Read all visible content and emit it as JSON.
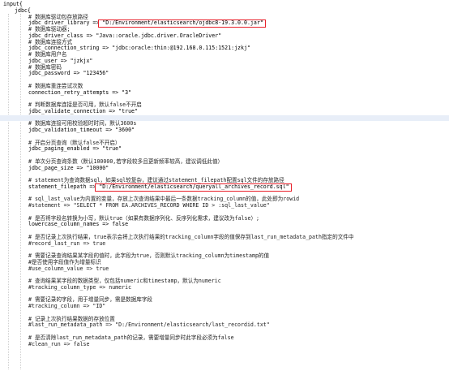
{
  "editor": {
    "colors": {
      "background": "#ffffff",
      "text": "#000000",
      "current_line": "#e8eef8",
      "highlight_box": "#e8202a"
    },
    "lines": [
      {
        "text": "input{",
        "indent": 0
      },
      {
        "text": "jdbc{",
        "indent": 1
      },
      {
        "text": "# 数据库驱动包存放路径",
        "indent": 2
      },
      {
        "text": "jdbc_driver_library => \"D:/Environment/elasticsearch/ojdbc8-19.3.0.0.jar\"",
        "indent": 2,
        "boxed": true
      },
      {
        "text": "# 数据库驱动器;",
        "indent": 2
      },
      {
        "text": "jdbc_driver_class => \"Java::oracle.jdbc.driver.OracleDriver\"",
        "indent": 2
      },
      {
        "text": "# 数据库连接方式",
        "indent": 2
      },
      {
        "text": "jdbc_connection_string => \"jdbc:oracle:thin:@192.168.0.115:1521:jzkj\"",
        "indent": 2
      },
      {
        "text": "# 数据库用户名",
        "indent": 2
      },
      {
        "text": "jdbc_user => \"jzkjx\"",
        "indent": 2
      },
      {
        "text": "# 数据库密码",
        "indent": 2
      },
      {
        "text": "jdbc_password => \"123456\"",
        "indent": 2
      },
      {
        "text": "",
        "indent": 2
      },
      {
        "text": "# 数据库重连尝试次数",
        "indent": 2
      },
      {
        "text": "connection_retry_attempts => \"3\"",
        "indent": 2
      },
      {
        "text": "",
        "indent": 2
      },
      {
        "text": "# 判断数据库连接是否可用，默认false不开启",
        "indent": 2
      },
      {
        "text": "jdbc_validate_connection => \"true\"",
        "indent": 2
      },
      {
        "text": "",
        "indent": 2,
        "current": true
      },
      {
        "text": "# 数据库连接可用校验超时时间，默认3600s",
        "indent": 2
      },
      {
        "text": "jdbc_validation_timeout => \"3600\"",
        "indent": 2
      },
      {
        "text": "",
        "indent": 2
      },
      {
        "text": "# 开启分页查询（默认false不开启）",
        "indent": 2
      },
      {
        "text": "jdbc_paging_enabled => \"true\"",
        "indent": 2
      },
      {
        "text": "",
        "indent": 2
      },
      {
        "text": "# 单次分页查询条数（默认100000,若字段较多且更新频率较高，建议调低此值）",
        "indent": 2
      },
      {
        "text": "jdbc_page_size => \"10000\"",
        "indent": 2
      },
      {
        "text": "",
        "indent": 2
      },
      {
        "text": "# statement为查询数据sql，如果sql较复杂，建议通过statement_filepath配置sql文件的存放路径",
        "indent": 2
      },
      {
        "text": "statement_filepath => \"D:/Environment/elasticsearch/queryall_archives_record.sql\"",
        "indent": 2,
        "boxed": true
      },
      {
        "text": "",
        "indent": 2
      },
      {
        "text": "# sql_last_value为内置的变量，存放上次查询结果中最后一条数据tracking_column的值，此处即为rowid",
        "indent": 2
      },
      {
        "text": "#statement => \"SELECT * FROM EA.ARCHIVES_RECORD WHERE ID > :sql_last_value\"",
        "indent": 2
      },
      {
        "text": "",
        "indent": 2
      },
      {
        "text": "# 是否将字段名转换为小写，默认true（如果有数据序列化、反序列化需求，建议改为false）;",
        "indent": 2
      },
      {
        "text": "lowercase_column_names => false",
        "indent": 2
      },
      {
        "text": "",
        "indent": 2
      },
      {
        "text": "# 是否记录上次执行结果，true表示会将上次执行结果的tracking_column字段的值保存到last_run_metadata_path指定的文件中",
        "indent": 2
      },
      {
        "text": "#record_last_run => true",
        "indent": 2
      },
      {
        "text": "",
        "indent": 2
      },
      {
        "text": "# 需要记录查询结果某字段的值时，此字段为true，否则默认tracking_column为timestamp的值",
        "indent": 2
      },
      {
        "text": "#是否使用字段值作为增量标识",
        "indent": 2
      },
      {
        "text": "#use_column_value => true",
        "indent": 2
      },
      {
        "text": "",
        "indent": 2
      },
      {
        "text": "# 查询结果某字段的数据类型，仅包括numeric和timestamp，默认为numeric",
        "indent": 2
      },
      {
        "text": "#tracking_column_type => numeric",
        "indent": 2
      },
      {
        "text": "",
        "indent": 2
      },
      {
        "text": "# 需要记录的字段，用于增量同步，需是数据库字段",
        "indent": 2
      },
      {
        "text": "#tracking_column => \"ID\"",
        "indent": 2
      },
      {
        "text": "",
        "indent": 2
      },
      {
        "text": "# 记录上次执行结果数据的存放位置",
        "indent": 2
      },
      {
        "text": "#last_run_metadata_path => \"D:/Environment/elasticsearch/last_recordid.txt\"",
        "indent": 2
      },
      {
        "text": "",
        "indent": 2
      },
      {
        "text": "# 是否清除last_run_metadata_path的记录，需要增量同步时此字段必须为false",
        "indent": 2
      },
      {
        "text": "#clean_run => false",
        "indent": 2
      }
    ]
  }
}
